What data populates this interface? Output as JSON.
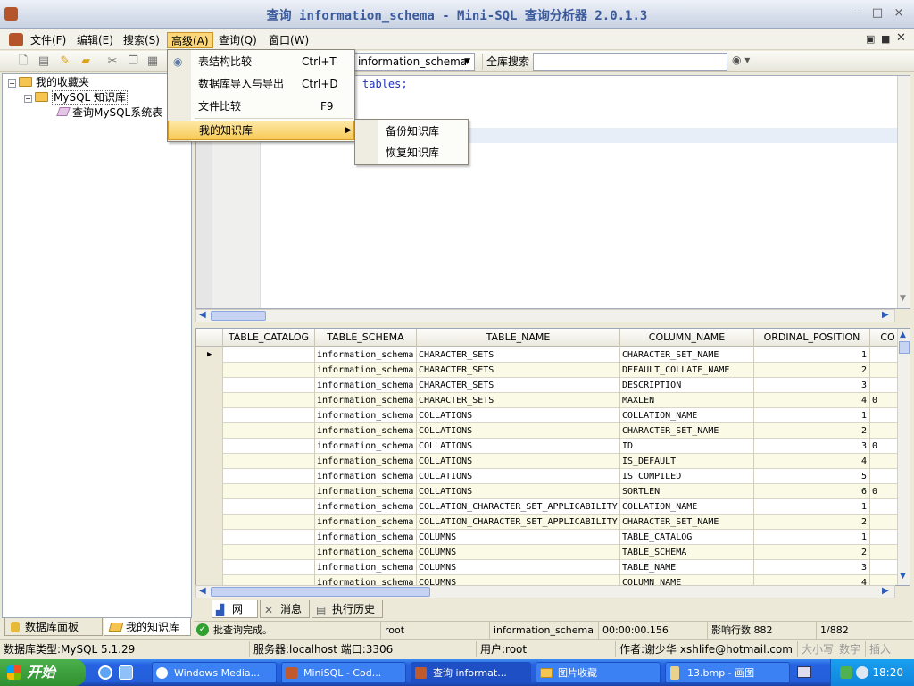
{
  "window": {
    "title": "查询 information_schema - Mini-SQL 查询分析器 2.0.1.3",
    "controls": [
      "–",
      "□",
      "×"
    ]
  },
  "menubar": [
    "文件(F)",
    "编辑(E)",
    "搜索(S)",
    "高级(A)",
    "查询(Q)",
    "窗口(W)"
  ],
  "toolbar": {
    "database_value": "information_schema",
    "search_label": "全库搜索",
    "search_value": ""
  },
  "advanced_menu": {
    "items": [
      {
        "label": "表结构比较",
        "shortcut": "Ctrl+T"
      },
      {
        "label": "数据库导入与导出",
        "shortcut": "Ctrl+D"
      },
      {
        "label": "文件比较",
        "shortcut": "F9"
      },
      {
        "label": "我的知识库",
        "shortcut": ""
      }
    ]
  },
  "submenu": {
    "items": [
      "备份知识库",
      "恢复知识库"
    ]
  },
  "tree": {
    "root": "我的收藏夹",
    "child": "MySQL 知识库",
    "leaf": "查询MySQL系统表"
  },
  "left_tabs": [
    "数据库面板",
    "我的知识库"
  ],
  "editor": {
    "code": "tables;"
  },
  "grid": {
    "columns": [
      "TABLE_CATALOG",
      "TABLE_SCHEMA",
      "TABLE_NAME",
      "COLUMN_NAME",
      "ORDINAL_POSITION",
      "CO"
    ],
    "rows": [
      [
        "",
        "information_schema",
        "CHARACTER_SETS",
        "CHARACTER_SET_NAME",
        "1",
        ""
      ],
      [
        "",
        "information_schema",
        "CHARACTER_SETS",
        "DEFAULT_COLLATE_NAME",
        "2",
        ""
      ],
      [
        "",
        "information_schema",
        "CHARACTER_SETS",
        "DESCRIPTION",
        "3",
        ""
      ],
      [
        "",
        "information_schema",
        "CHARACTER_SETS",
        "MAXLEN",
        "4",
        "0"
      ],
      [
        "",
        "information_schema",
        "COLLATIONS",
        "COLLATION_NAME",
        "1",
        ""
      ],
      [
        "",
        "information_schema",
        "COLLATIONS",
        "CHARACTER_SET_NAME",
        "2",
        ""
      ],
      [
        "",
        "information_schema",
        "COLLATIONS",
        "ID",
        "3",
        "0"
      ],
      [
        "",
        "information_schema",
        "COLLATIONS",
        "IS_DEFAULT",
        "4",
        ""
      ],
      [
        "",
        "information_schema",
        "COLLATIONS",
        "IS_COMPILED",
        "5",
        ""
      ],
      [
        "",
        "information_schema",
        "COLLATIONS",
        "SORTLEN",
        "6",
        "0"
      ],
      [
        "",
        "information_schema",
        "COLLATION_CHARACTER_SET_APPLICABILITY",
        "COLLATION_NAME",
        "1",
        ""
      ],
      [
        "",
        "information_schema",
        "COLLATION_CHARACTER_SET_APPLICABILITY",
        "CHARACTER_SET_NAME",
        "2",
        ""
      ],
      [
        "",
        "information_schema",
        "COLUMNS",
        "TABLE_CATALOG",
        "1",
        ""
      ],
      [
        "",
        "information_schema",
        "COLUMNS",
        "TABLE_SCHEMA",
        "2",
        ""
      ],
      [
        "",
        "information_schema",
        "COLUMNS",
        "TABLE_NAME",
        "3",
        ""
      ],
      [
        "",
        "information_schema",
        "COLUMNS",
        "COLUMN_NAME",
        "4",
        ""
      ]
    ]
  },
  "result_tabs": [
    "网格",
    "消息",
    "执行历史"
  ],
  "status_bar": {
    "message": "批查询完成。",
    "user": "root",
    "database": "information_schema",
    "elapsed": "00:00:00.156",
    "affected": "影响行数 882",
    "position": "1/882"
  },
  "info_bar": {
    "db_type": "数据库类型:MySQL 5.1.29",
    "server": "服务器:localhost  端口:3306",
    "user": "用户:root",
    "author": "作者:谢少华  xshlife@hotmail.com",
    "caps": "大小写",
    "num": "数字",
    "insert": "插入"
  },
  "taskbar": {
    "start": "开始",
    "tasks": [
      "Windows Media...",
      "MiniSQL - Cod...",
      "查询 informat...",
      "图片收藏",
      "13.bmp - 画图"
    ],
    "clock": "18:20"
  },
  "colors": {
    "menu_highlight": "#f8ca57",
    "odd_row": "#ffffff",
    "even_row": "#fafae6",
    "taskbar": "#245edb"
  }
}
